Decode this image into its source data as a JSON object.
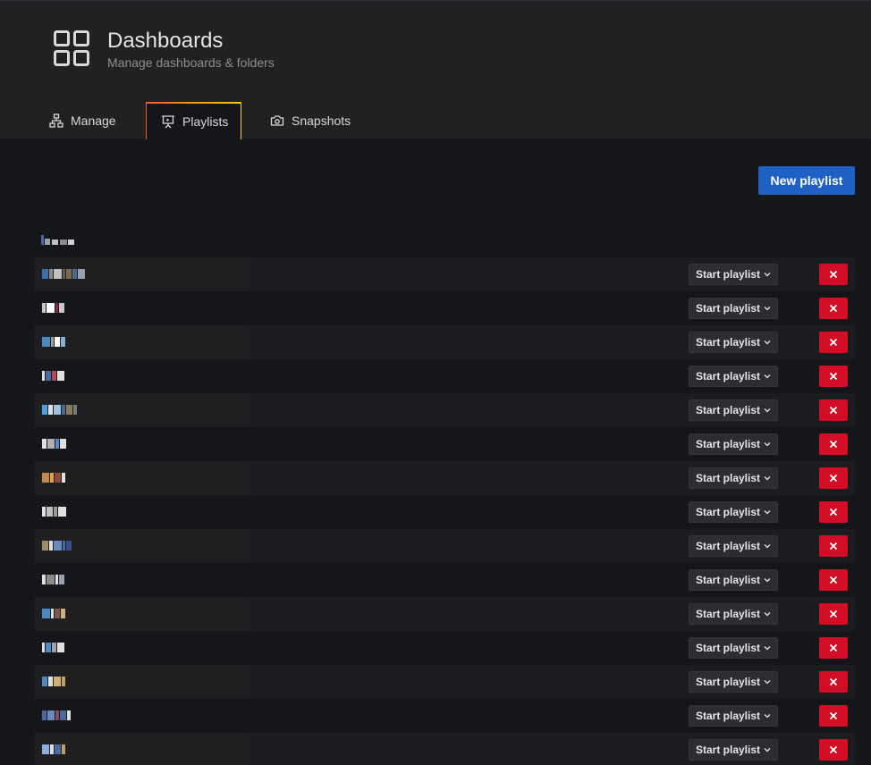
{
  "header": {
    "title": "Dashboards",
    "subtitle": "Manage dashboards & folders",
    "icon": "dashboards-grid-icon"
  },
  "tabs": [
    {
      "label": "Manage",
      "icon": "sitemap-icon"
    },
    {
      "label": "Playlists",
      "icon": "presentation-icon",
      "active": true
    },
    {
      "label": "Snapshots",
      "icon": "camera-icon"
    }
  ],
  "toolbar": {
    "new_playlist_label": "New playlist"
  },
  "playlists": {
    "start_label": "Start playlist",
    "delete_icon": "close-icon",
    "rows": [
      {
        "name_colors": [
          "#3a6fa8",
          "#8a8a8a",
          "#c0c0c0",
          "#5a5a5a",
          "#7a6a4a",
          "#4a6a8a",
          "#9aa0b0"
        ]
      },
      {
        "name_colors": [
          "#c8c8c8",
          "#ffffff",
          "#8a2a3a",
          "#c8c8c8"
        ]
      },
      {
        "name_colors": [
          "#4a8ac0",
          "#a0a0a0",
          "#ffffff",
          "#8ab0d0"
        ]
      },
      {
        "name_colors": [
          "#e0e0e0",
          "#4a6aa0",
          "#b04a5a",
          "#e0e0e0"
        ]
      },
      {
        "name_colors": [
          "#4aa0e0",
          "#e0e0e0",
          "#a0c0e0",
          "#4a6a8a",
          "#8a7a5a",
          "#7a7a7a"
        ]
      },
      {
        "name_colors": [
          "#e0e0e0",
          "#b0b0b0",
          "#5a8ac0",
          "#e0e0e0"
        ]
      },
      {
        "name_colors": [
          "#c08a4a",
          "#e0a050",
          "#8a4a3a",
          "#e0e0e0"
        ]
      },
      {
        "name_colors": [
          "#e0e0e0",
          "#c0c0c0",
          "#9a9aa0",
          "#e0e0e0"
        ]
      },
      {
        "name_colors": [
          "#a08a6a",
          "#e0e0e0",
          "#6a8ac0",
          "#4a6aa0",
          "#3a4a8a"
        ]
      },
      {
        "name_colors": [
          "#e0e0e0",
          "#8a8a8a",
          "#e0e0e0",
          "#9aa0b0"
        ]
      },
      {
        "name_colors": [
          "#4a8ac0",
          "#e0e0e0",
          "#7a5a4a",
          "#d0b080"
        ]
      },
      {
        "name_colors": [
          "#e0e0e0",
          "#4a8ac0",
          "#a0a0a0",
          "#e0e0e0"
        ]
      },
      {
        "name_colors": [
          "#4a8ac0",
          "#e0e0e0",
          "#d0b070",
          "#c0a060"
        ]
      },
      {
        "name_colors": [
          "#4a6aa0",
          "#6a8ac0",
          "#8a4a5a",
          "#4a6aa0",
          "#e0e0e0"
        ]
      },
      {
        "name_colors": [
          "#8ab0e0",
          "#e0e0e0",
          "#4a6aa0",
          "#c0a060"
        ]
      }
    ]
  }
}
